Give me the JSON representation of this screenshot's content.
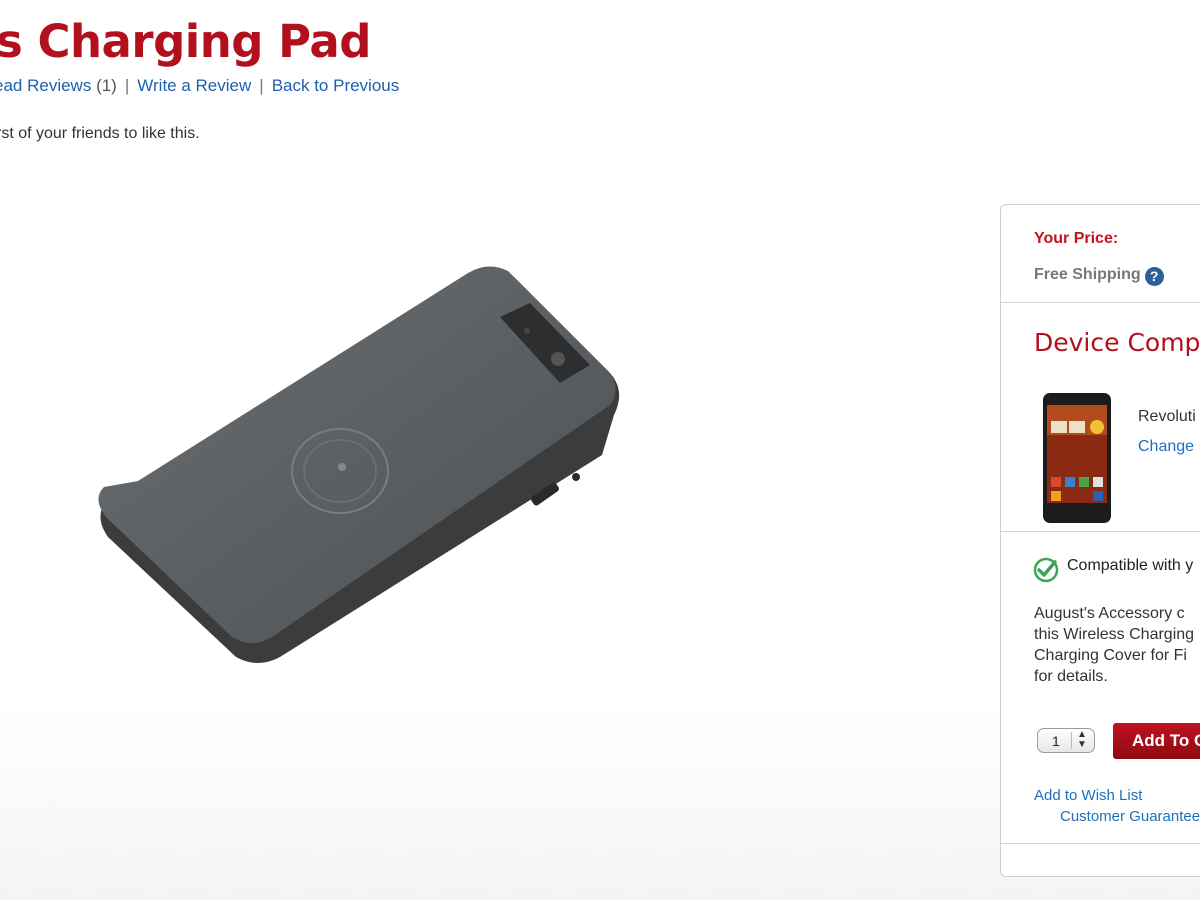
{
  "product": {
    "title": "s Charging Pad",
    "reviews_link": "ead Reviews",
    "reviews_count": "(1)",
    "separator": "|",
    "write_review": "Write a Review",
    "back_link": "Back to Previous",
    "friends_text": "rst of your friends to like this."
  },
  "panel": {
    "price_label": "Your Price:",
    "shipping_label": "Free Shipping",
    "help_icon_glyph": "?",
    "compat_heading": "Device Compat",
    "device_name": "Revoluti",
    "change_link": "Change",
    "compat_status": "Compatible with y",
    "description_lines": [
      "August's Accessory c",
      "this Wireless Charging",
      "Charging Cover for Fi",
      "for details."
    ],
    "quantity": "1",
    "add_to_cart": "Add To C",
    "wish_list": "Add to Wish List",
    "guarantee": "Customer Guarantee"
  },
  "colors": {
    "brand_red": "#b3101e",
    "link_blue": "#1f6fc0",
    "help_blue": "#2f5f99",
    "check_green": "#3aa655"
  },
  "icons": {
    "help": "help-circle-icon",
    "check": "check-circle-icon",
    "quantity_arrows": "up-down-arrows-icon"
  }
}
